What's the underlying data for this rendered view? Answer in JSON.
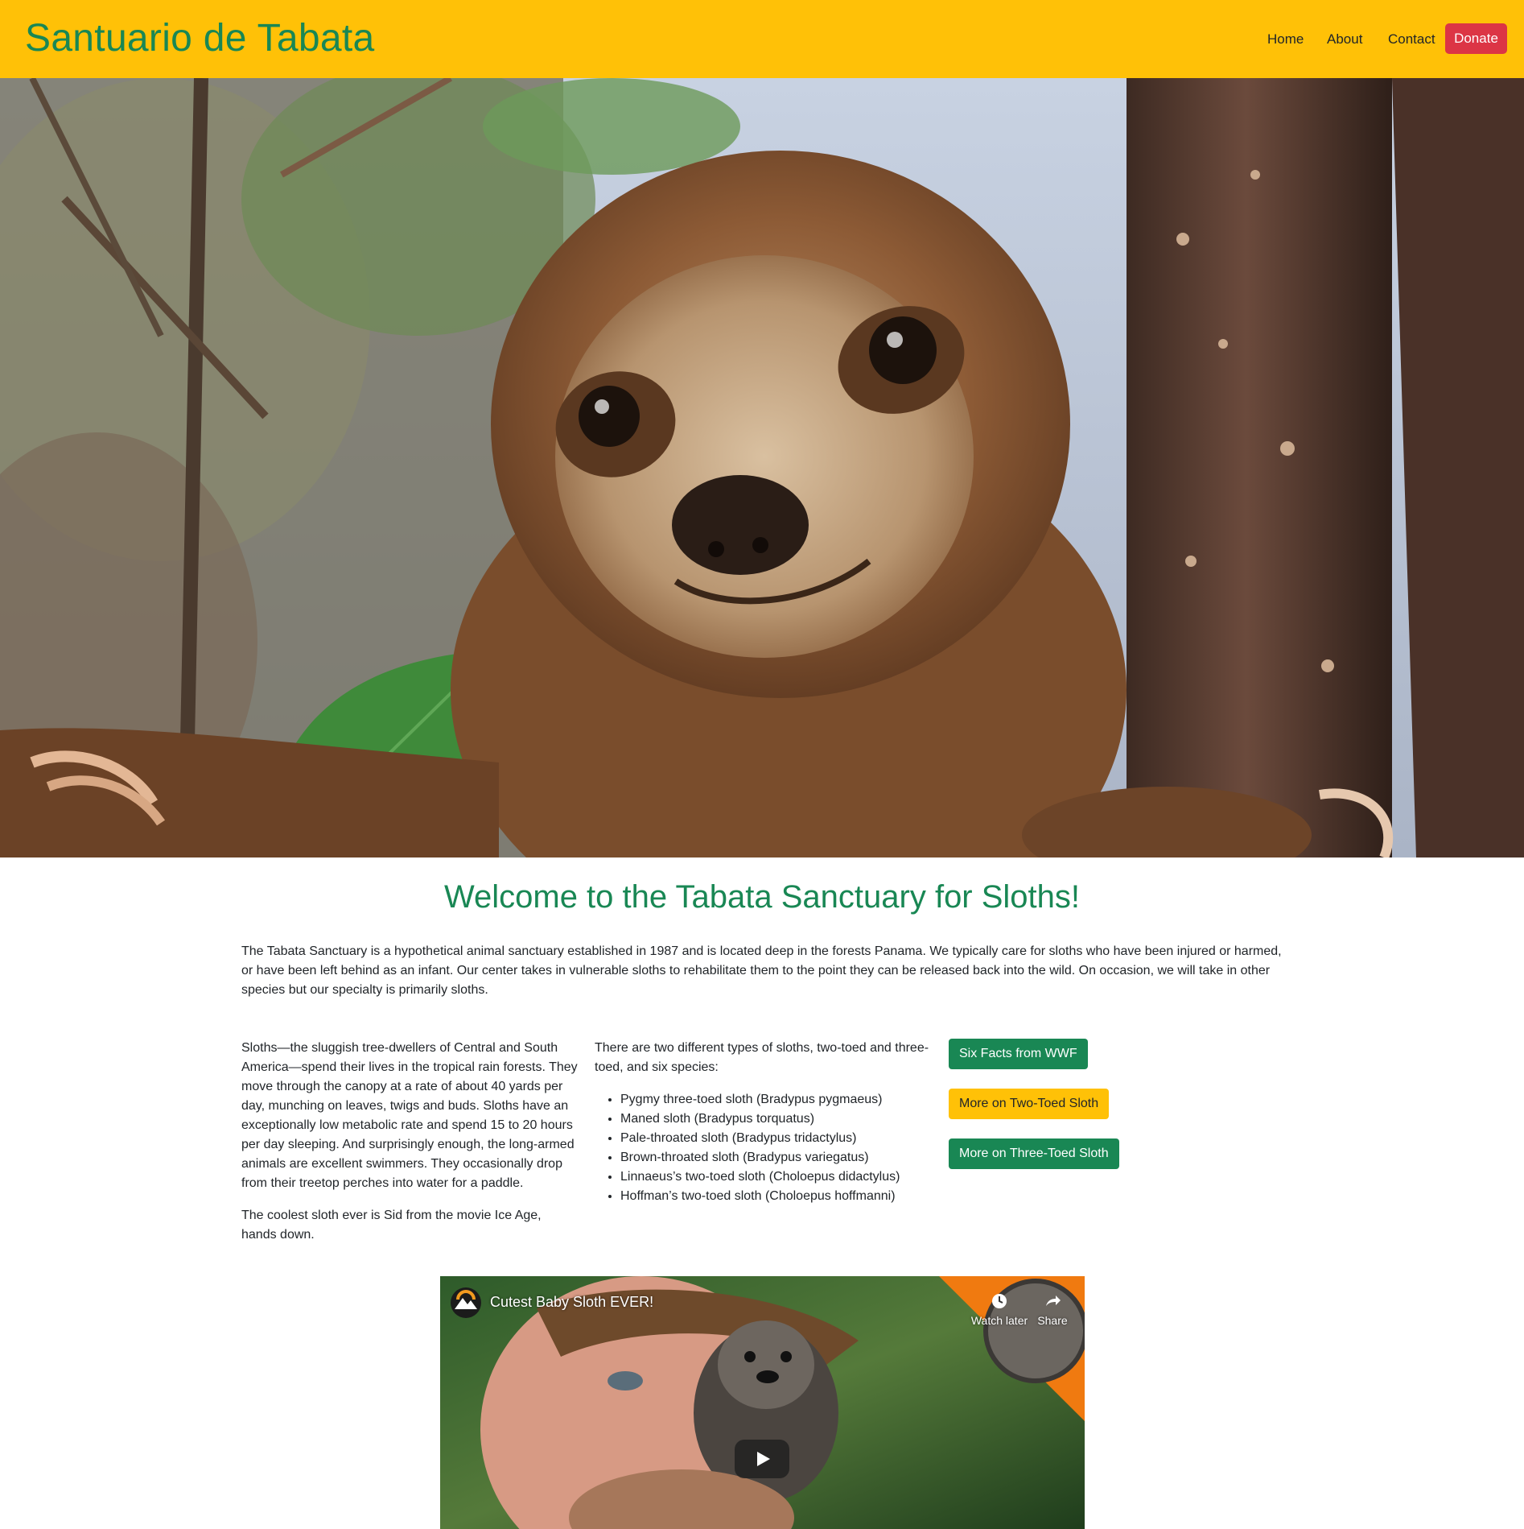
{
  "navbar": {
    "brand": "Santuario de Tabata",
    "links": [
      "Home",
      "About",
      "Contact"
    ],
    "donate_label": "Donate",
    "colors": {
      "background": "#ffc107",
      "brand": "#198754",
      "donate": "#dc3545"
    }
  },
  "hero": {
    "icon": "sloth-photo"
  },
  "main": {
    "heading": "Welcome to the Tabata Sanctuary for Sloths!",
    "intro": "The Tabata Sanctuary is a hypothetical animal sanctuary established in 1987 and is located deep in the forests Panama. We typically care for sloths who have been injured or harmed, or have been left behind as an infant. Our center takes in vulnerable sloths to rehabilitate them to the point they can be released back into the wild. On occasion, we will take in other species but our specialty is primarily sloths.",
    "col1": {
      "p1": "Sloths—the sluggish tree-dwellers of Central and South America—spend their lives in the tropical rain forests. They move through the canopy at a rate of about 40 yards per day, munching on leaves, twigs and buds. Sloths have an exceptionally low metabolic rate and spend 15 to 20 hours per day sleeping. And surprisingly enough, the long-armed animals are excellent swimmers. They occasionally drop from their treetop perches into water for a paddle.",
      "p2": "The coolest sloth ever is Sid from the movie Ice Age, hands down."
    },
    "col2": {
      "intro": "There are two different types of sloths, two-toed and three-toed, and six species:",
      "species": [
        "Pygmy three-toed sloth (Bradypus pygmaeus)",
        "Maned sloth (Bradypus torquatus)",
        "Pale-throated sloth (Bradypus tridactylus)",
        "Brown-throated sloth (Bradypus variegatus)",
        "Linnaeus’s two-toed sloth (Choloepus didactylus)",
        "Hoffman’s two-toed sloth (Choloepus hoffmanni)"
      ]
    },
    "buttons": {
      "wwf": "Six Facts from WWF",
      "two_toed": "More on Two-Toed Sloth",
      "three_toed": "More on Three-Toed Sloth"
    }
  },
  "video": {
    "title": "Cutest Baby Sloth EVER!",
    "watch_later": "Watch later",
    "share": "Share"
  }
}
